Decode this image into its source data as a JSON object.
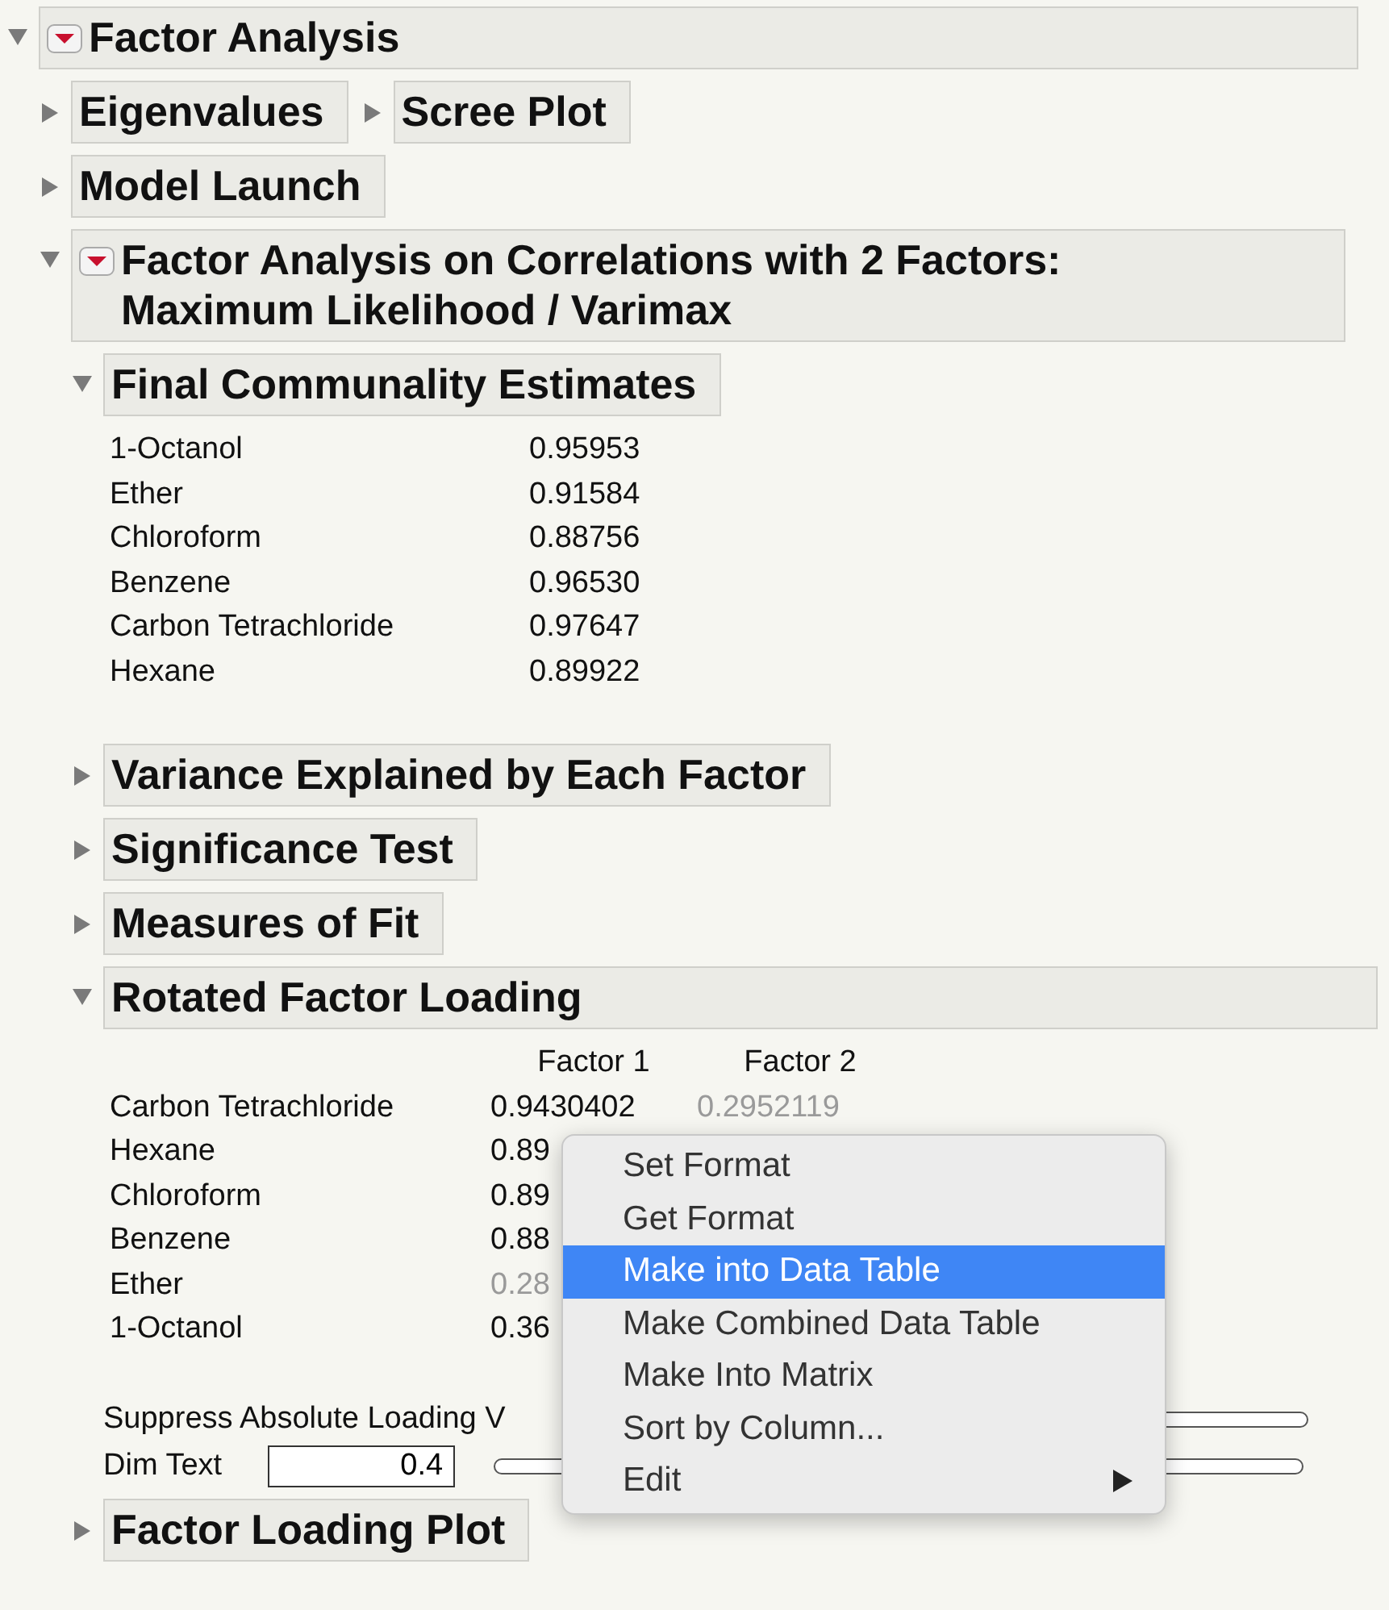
{
  "report": {
    "kind": "outline",
    "title": "Factor Analysis",
    "expanded": true,
    "menu": true,
    "children": [
      {
        "kind": "outline_row",
        "items": [
          {
            "title": "Eigenvalues",
            "expanded": false
          },
          {
            "title": "Scree Plot",
            "expanded": false
          }
        ]
      },
      {
        "kind": "outline",
        "title": "Model Launch",
        "expanded": false
      },
      {
        "kind": "outline",
        "title": "Factor Analysis on Correlations with 2 Factors: Maximum Likelihood / Varimax",
        "expanded": true,
        "menu": true,
        "children": [
          {
            "kind": "outline",
            "title": "Final Communality Estimates",
            "expanded": true,
            "children": [
              {
                "kind": "table",
                "rows": [
                  {
                    "label": "1-Octanol",
                    "cells": [
                      {
                        "text": "0.95953",
                        "dim": false
                      }
                    ]
                  },
                  {
                    "label": "Ether",
                    "cells": [
                      {
                        "text": "0.91584",
                        "dim": false
                      }
                    ]
                  },
                  {
                    "label": "Chloroform",
                    "cells": [
                      {
                        "text": "0.88756",
                        "dim": false
                      }
                    ]
                  },
                  {
                    "label": "Benzene",
                    "cells": [
                      {
                        "text": "0.96530",
                        "dim": false
                      }
                    ]
                  },
                  {
                    "label": "Carbon Tetrachloride",
                    "cells": [
                      {
                        "text": "0.97647",
                        "dim": false
                      }
                    ]
                  },
                  {
                    "label": "Hexane",
                    "cells": [
                      {
                        "text": "0.89922",
                        "dim": false
                      }
                    ]
                  }
                ]
              }
            ]
          },
          {
            "kind": "outline",
            "title": "Variance Explained by Each Factor",
            "expanded": false
          },
          {
            "kind": "outline",
            "title": "Significance Test",
            "expanded": false
          },
          {
            "kind": "outline",
            "title": "Measures of Fit",
            "expanded": false
          },
          {
            "kind": "outline",
            "title": "Rotated Factor Loading",
            "expanded": true,
            "children": [
              {
                "kind": "table",
                "columns": [
                  "Factor 1",
                  "Factor 2"
                ],
                "rows": [
                  {
                    "label": "Carbon Tetrachloride",
                    "cells": [
                      {
                        "text": "0.9430402",
                        "dim": false
                      },
                      {
                        "text": "0.2952119",
                        "dim": true
                      }
                    ]
                  },
                  {
                    "label": "Hexane",
                    "cells": [
                      {
                        "text": "0.89",
                        "dim": false
                      }
                    ]
                  },
                  {
                    "label": "Chloroform",
                    "cells": [
                      {
                        "text": "0.89",
                        "dim": false
                      }
                    ]
                  },
                  {
                    "label": "Benzene",
                    "cells": [
                      {
                        "text": "0.88",
                        "dim": false
                      }
                    ]
                  },
                  {
                    "label": "Ether",
                    "cells": [
                      {
                        "text": "0.28",
                        "dim": true
                      }
                    ]
                  },
                  {
                    "label": "1-Octanol",
                    "cells": [
                      {
                        "text": "0.36",
                        "dim": false
                      }
                    ]
                  }
                ]
              },
              {
                "kind": "controls",
                "items": [
                  {
                    "kind": "slider",
                    "label": "Suppress Absolute Loading V"
                  },
                  {
                    "kind": "field",
                    "label": "Dim Text",
                    "value": "0.4"
                  }
                ]
              }
            ]
          },
          {
            "kind": "outline",
            "title": "Factor Loading Plot",
            "expanded": false
          }
        ]
      }
    ]
  },
  "context_menu": {
    "items": [
      {
        "label": "Set Format",
        "selected": false,
        "submenu": false
      },
      {
        "label": "Get Format",
        "selected": false,
        "submenu": false
      },
      {
        "label": "Make into Data Table",
        "selected": true,
        "submenu": false
      },
      {
        "label": "Make Combined Data Table",
        "selected": false,
        "submenu": false
      },
      {
        "label": "Make Into Matrix",
        "selected": false,
        "submenu": false
      },
      {
        "label": "Sort by Column...",
        "selected": false,
        "submenu": false
      },
      {
        "label": "Edit",
        "selected": false,
        "submenu": true
      }
    ]
  }
}
